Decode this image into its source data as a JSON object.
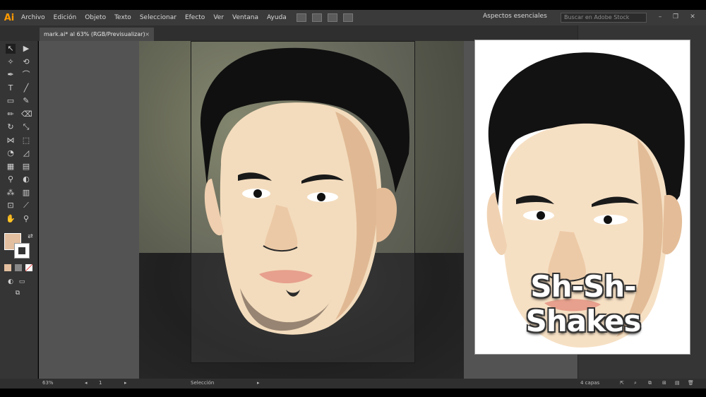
{
  "app": {
    "logo": "Ai",
    "menu": [
      "Archivo",
      "Edición",
      "Objeto",
      "Texto",
      "Seleccionar",
      "Efecto",
      "Ver",
      "Ventana",
      "Ayuda"
    ],
    "workspace": "Aspectos esenciales",
    "search_placeholder": "Buscar en Adobe Stock",
    "window_controls": [
      "–",
      "❐",
      "✕"
    ]
  },
  "document_tab": {
    "title": "mark.ai* al 63% (RGB/Previsualizar)",
    "close": "×"
  },
  "tools": [
    {
      "icon": "selection-icon",
      "glyph": "↖"
    },
    {
      "icon": "direct-selection-icon",
      "glyph": "▶"
    },
    {
      "icon": "magic-wand-icon",
      "glyph": "✧"
    },
    {
      "icon": "lasso-icon",
      "glyph": "⟲"
    },
    {
      "icon": "pen-icon",
      "glyph": "✒"
    },
    {
      "icon": "curvature-icon",
      "glyph": "⌒"
    },
    {
      "icon": "type-icon",
      "glyph": "T"
    },
    {
      "icon": "line-icon",
      "glyph": "╱"
    },
    {
      "icon": "rectangle-icon",
      "glyph": "▭"
    },
    {
      "icon": "paintbrush-icon",
      "glyph": "✎"
    },
    {
      "icon": "pencil-icon",
      "glyph": "✏"
    },
    {
      "icon": "eraser-icon",
      "glyph": "⌫"
    },
    {
      "icon": "rotate-icon",
      "glyph": "↻"
    },
    {
      "icon": "scale-icon",
      "glyph": "⤡"
    },
    {
      "icon": "width-icon",
      "glyph": "⋈"
    },
    {
      "icon": "free-transform-icon",
      "glyph": "⬚"
    },
    {
      "icon": "shape-builder-icon",
      "glyph": "◔"
    },
    {
      "icon": "perspective-icon",
      "glyph": "◿"
    },
    {
      "icon": "mesh-icon",
      "glyph": "▦"
    },
    {
      "icon": "gradient-icon",
      "glyph": "▤"
    },
    {
      "icon": "eyedropper-icon",
      "glyph": "⚲"
    },
    {
      "icon": "blend-icon",
      "glyph": "◐"
    },
    {
      "icon": "symbol-sprayer-icon",
      "glyph": "⁂"
    },
    {
      "icon": "column-graph-icon",
      "glyph": "▥"
    },
    {
      "icon": "artboard-icon",
      "glyph": "⊡"
    },
    {
      "icon": "slice-icon",
      "glyph": "⟋"
    },
    {
      "icon": "hand-icon",
      "glyph": "✋"
    },
    {
      "icon": "zoom-icon",
      "glyph": "⚲"
    }
  ],
  "colors": {
    "fill": "#e3bf9f",
    "stroke": "#ffffff",
    "accent": "#ff9a00"
  },
  "preview": {
    "caption": "Sh-Sh-Shakes"
  },
  "statusbar": {
    "zoom": "63%",
    "artboard_number": "1",
    "tool_status": "Selección",
    "panel_status": "4 capas"
  }
}
